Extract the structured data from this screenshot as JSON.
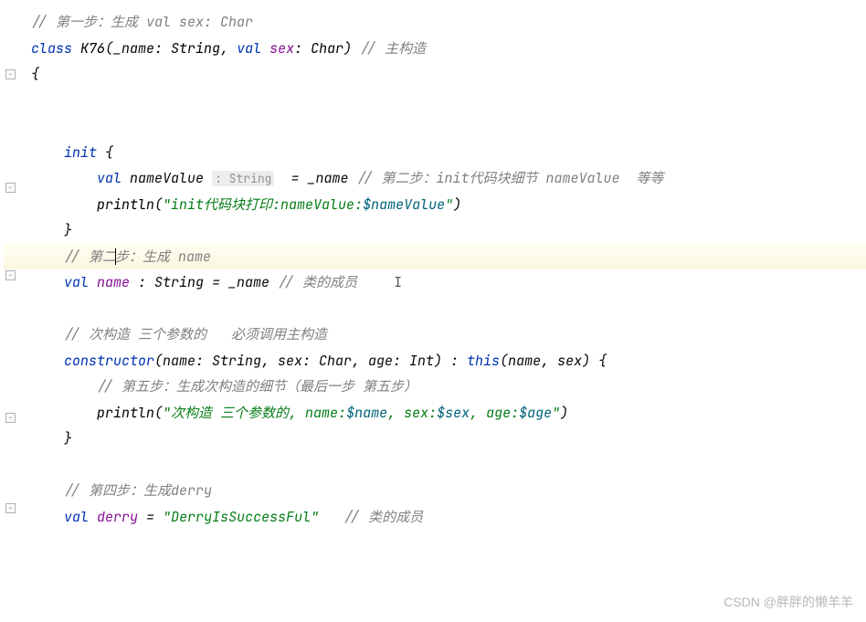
{
  "code": {
    "l1": "// 第一步：生成 val sex: Char",
    "l2_class": "class ",
    "l2_name": "K76",
    "l2_open": "(_name: ",
    "l2_type1": "String",
    "l2_mid": ", ",
    "l2_val": "val ",
    "l2_sex": "sex",
    "l2_colon": ": ",
    "l2_type2": "Char",
    "l2_close": ") ",
    "l2_comment": "// 主构造",
    "l3": "{",
    "l4_init": "init ",
    "l4_open": "{",
    "l5_val": "val ",
    "l5_name": "nameValue",
    "l5_hint": ": String",
    "l5_eq": "  = _name ",
    "l5_comment": "// 第二步：init代码块细节 nameValue  等等",
    "l6_func": "println",
    "l6_open": "(",
    "l6_str1": "\"init代码块打印:nameValue:",
    "l6_tmpl": "$nameValue",
    "l6_str2": "\"",
    "l6_close": ")",
    "l7": "}",
    "l8_c1": "// 第二",
    "l8_c2": "步：生成 name",
    "l9_val": "val ",
    "l9_name": "name ",
    "l9_rest": ": String = _name ",
    "l9_comment": "// 类的成员",
    "l10_comment": "// 次构造 三个参数的   必须调用主构造",
    "l11_ctor": "constructor",
    "l11_params": "(name: String, sex: Char, age: Int) : ",
    "l11_this": "this",
    "l11_args": "(name, sex) {",
    "l12_comment": "// 第五步：生成次构造的细节（最后一步 第五步）",
    "l13_func": "println",
    "l13_open": "(",
    "l13_str1": "\"次构造 三个参数的, name:",
    "l13_t1": "$name",
    "l13_str2": ", sex:",
    "l13_t2": "$sex",
    "l13_str3": ", age:",
    "l13_t3": "$age",
    "l13_str4": "\"",
    "l13_close": ")",
    "l14": "}",
    "l15_comment": "// 第四步：生成derry",
    "l16_val": "val ",
    "l16_name": "derry ",
    "l16_eq": "= ",
    "l16_str": "\"DerryIsSuccessFul\"",
    "l16_sp": "   ",
    "l16_comment": "// 类的成员"
  },
  "watermark": "CSDN @胖胖的懒羊羊",
  "colors": {
    "comment": "#808080",
    "keyword": "#0033b3",
    "property": "#871094",
    "string": "#067d17"
  }
}
